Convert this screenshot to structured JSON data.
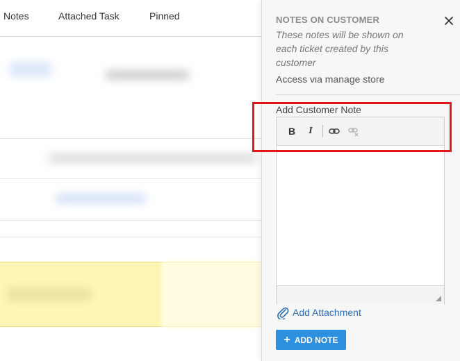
{
  "tabs": [
    {
      "label": "Notes"
    },
    {
      "label": "Attached Task"
    },
    {
      "label": "Pinned"
    }
  ],
  "panel": {
    "title": "NOTES ON CUSTOMER",
    "subtitle": "These notes will be shown on each ticket created by this customer",
    "existing_note": "Access via manage store",
    "field_label": "Add Customer Note",
    "attachment_label": "Add Attachment",
    "add_button_label": "ADD NOTE",
    "add_button_plus": "+"
  },
  "toolbar": {
    "bold": "B",
    "italic": "I"
  },
  "icons": {
    "close": "close-icon",
    "link": "link-icon",
    "unlink": "unlink-icon",
    "attach": "paperclip-icon"
  },
  "colors": {
    "accent": "#2d8fe0",
    "link": "#2c6fb7",
    "highlight": "#e3161a",
    "note_banner": "#fdf6b5"
  }
}
